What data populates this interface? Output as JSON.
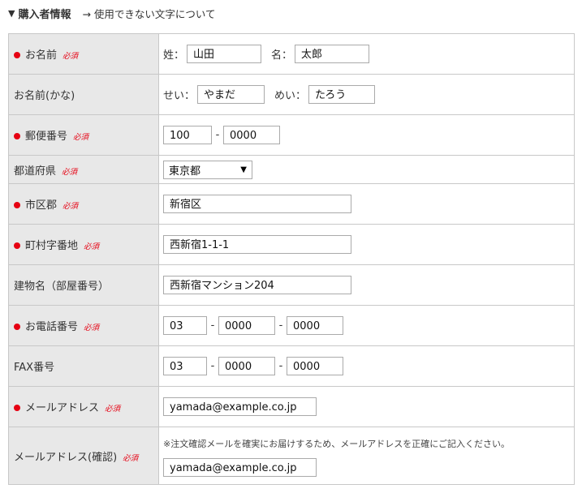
{
  "header": {
    "title": "購入者情報",
    "link": "→ 使用できない文字について"
  },
  "required_label": "必須",
  "rows": {
    "name": {
      "label": "お名前",
      "sei_prefix": "姓：",
      "sei_value": "山田",
      "mei_prefix": "名：",
      "mei_value": "太郎"
    },
    "kana": {
      "label": "お名前(かな)",
      "sei_prefix": "せい：",
      "sei_value": "やまだ",
      "mei_prefix": "めい：",
      "mei_value": "たろう"
    },
    "postal": {
      "label": "郵便番号",
      "part1": "100",
      "part2": "0000",
      "sep": "-"
    },
    "prefecture": {
      "label": "都道府県",
      "selected": "東京都"
    },
    "city": {
      "label": "市区郡",
      "value": "新宿区"
    },
    "town": {
      "label": "町村字番地",
      "value": "西新宿1-1-1"
    },
    "building": {
      "label": "建物名（部屋番号）",
      "value": "西新宿マンション204"
    },
    "phone": {
      "label": "お電話番号",
      "part1": "03",
      "part2": "0000",
      "part3": "0000",
      "sep": "-"
    },
    "fax": {
      "label": "FAX番号",
      "part1": "03",
      "part2": "0000",
      "part3": "0000",
      "sep": "-"
    },
    "email": {
      "label": "メールアドレス",
      "value": "yamada@example.co.jp"
    },
    "email_confirm": {
      "label": "メールアドレス(確認)",
      "note": "※注文確認メールを確実にお届けするため、メールアドレスを正確にご記入ください。",
      "value": "yamada@example.co.jp"
    }
  },
  "colors": {
    "required": "#e60012",
    "label_bg": "#e8e8e8",
    "border": "#c8c8c8"
  }
}
